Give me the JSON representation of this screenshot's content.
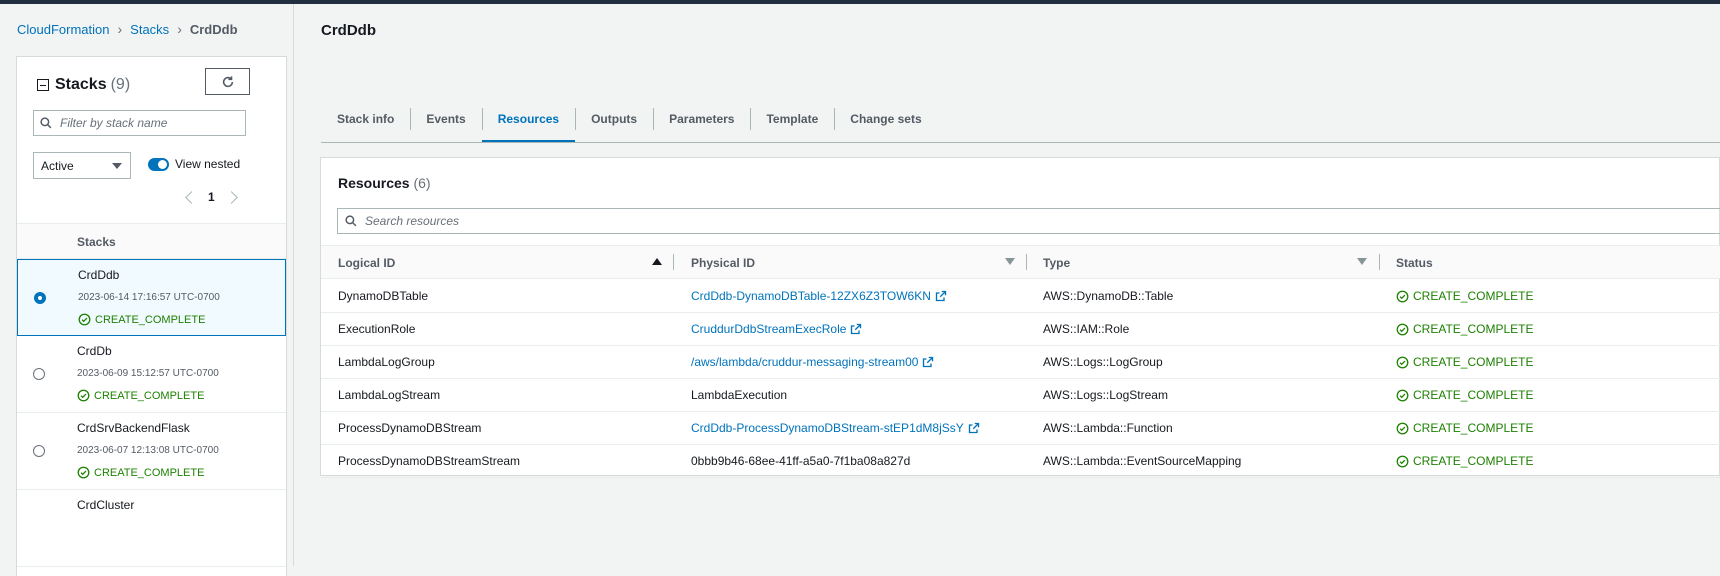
{
  "breadcrumb": {
    "root": "CloudFormation",
    "stacks": "Stacks",
    "current": "CrdDdb"
  },
  "sidebar": {
    "title": "Stacks",
    "count": "(9)",
    "filter_placeholder": "Filter by stack name",
    "status_filter": "Active",
    "view_nested_label": "View nested",
    "page": "1",
    "column_header": "Stacks",
    "stacks": [
      {
        "name": "CrdDdb",
        "date": "2023-06-14 17:16:57 UTC-0700",
        "status": "CREATE_COMPLETE",
        "selected": true
      },
      {
        "name": "CrdDb",
        "date": "2023-06-09 15:12:57 UTC-0700",
        "status": "CREATE_COMPLETE",
        "selected": false
      },
      {
        "name": "CrdSrvBackendFlask",
        "date": "2023-06-07 12:13:08 UTC-0700",
        "status": "CREATE_COMPLETE",
        "selected": false
      },
      {
        "name": "CrdCluster",
        "date": "",
        "status": "",
        "selected": false
      }
    ]
  },
  "main": {
    "title": "CrdDdb",
    "tabs": [
      "Stack info",
      "Events",
      "Resources",
      "Outputs",
      "Parameters",
      "Template",
      "Change sets"
    ],
    "active_tab": "Resources",
    "resources": {
      "title": "Resources",
      "count": "(6)",
      "search_placeholder": "Search resources",
      "columns": [
        "Logical ID",
        "Physical ID",
        "Type",
        "Status"
      ],
      "rows": [
        {
          "logical": "DynamoDBTable",
          "physical": "CrdDdb-DynamoDBTable-12ZX6Z3TOW6KN",
          "link": true,
          "type": "AWS::DynamoDB::Table",
          "status": "CREATE_COMPLETE"
        },
        {
          "logical": "ExecutionRole",
          "physical": "CruddurDdbStreamExecRole",
          "link": true,
          "type": "AWS::IAM::Role",
          "status": "CREATE_COMPLETE"
        },
        {
          "logical": "LambdaLogGroup",
          "physical": "/aws/lambda/cruddur-messaging-stream00",
          "link": true,
          "type": "AWS::Logs::LogGroup",
          "status": "CREATE_COMPLETE"
        },
        {
          "logical": "LambdaLogStream",
          "physical": "LambdaExecution",
          "link": false,
          "type": "AWS::Logs::LogStream",
          "status": "CREATE_COMPLETE"
        },
        {
          "logical": "ProcessDynamoDBStream",
          "physical": "CrdDdb-ProcessDynamoDBStream-stEP1dM8jSsY",
          "link": true,
          "type": "AWS::Lambda::Function",
          "status": "CREATE_COMPLETE"
        },
        {
          "logical": "ProcessDynamoDBStreamStream",
          "physical": "0bbb9b46-68ee-41ff-a5a0-7f1ba08a827d",
          "link": false,
          "type": "AWS::Lambda::EventSourceMapping",
          "status": "CREATE_COMPLETE"
        }
      ]
    }
  },
  "colors": {
    "link": "#0073bb",
    "success": "#1d8102",
    "topbar": "#232f3e"
  }
}
